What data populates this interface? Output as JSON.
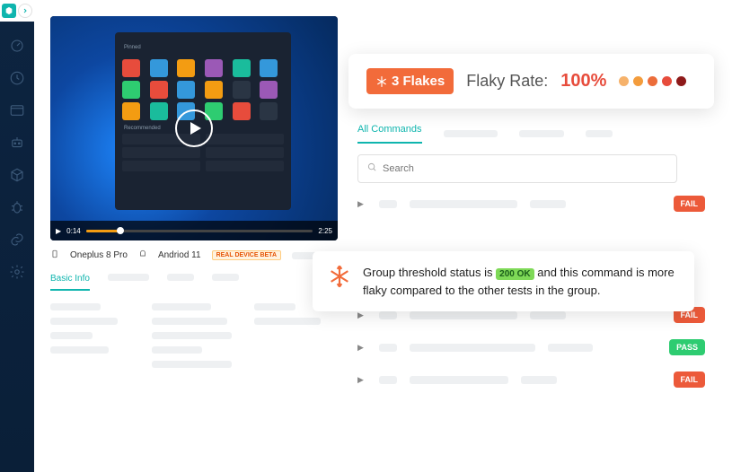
{
  "sidebar": {
    "icons": [
      "dashboard",
      "clock",
      "browser",
      "robot",
      "cube",
      "bug",
      "link",
      "gear"
    ]
  },
  "video": {
    "current_time": "0:14",
    "duration": "2:25"
  },
  "device": {
    "name": "Oneplus 8 Pro",
    "os": "Andriod 11",
    "badge": "REAL DEVICE BETA"
  },
  "info_tabs": {
    "active": "Basic Info"
  },
  "flaky": {
    "badge": "3 Flakes",
    "label": "Flaky Rate:",
    "value": "100%"
  },
  "commands": {
    "tab_active": "All Commands",
    "search_placeholder": "Search",
    "rows": [
      {
        "status": "FAIL"
      },
      {
        "status": "FAIL"
      },
      {
        "status": "PASS"
      },
      {
        "status": "FAIL"
      }
    ]
  },
  "threshold": {
    "pre": "Group threshold status is",
    "ok": "200 OK",
    "post": "and this command is more flaky compared to the other tests in the group."
  }
}
